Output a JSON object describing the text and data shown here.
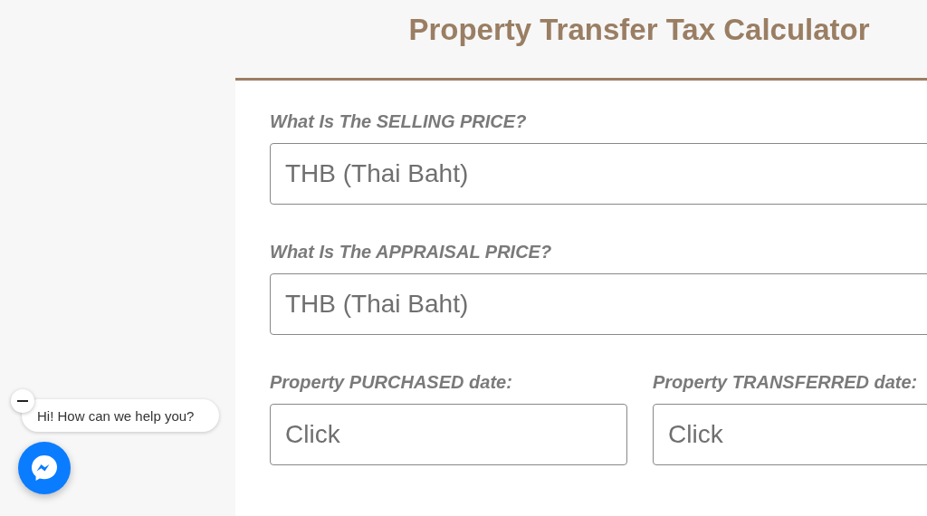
{
  "title": "Property Transfer Tax Calculator",
  "fields": [
    {
      "label": "What Is The SELLING PRICE?",
      "placeholder": "THB (Thai Baht)"
    },
    {
      "label": "What Is The APPRAISAL PRICE?",
      "placeholder": "THB (Thai Baht)"
    }
  ],
  "date_fields": [
    {
      "label": "Property PURCHASED date:",
      "placeholder": "Click"
    },
    {
      "label": "Property TRANSFERRED date:",
      "placeholder": "Click"
    }
  ],
  "chat": {
    "greeting": "Hi! How can we help you?"
  }
}
